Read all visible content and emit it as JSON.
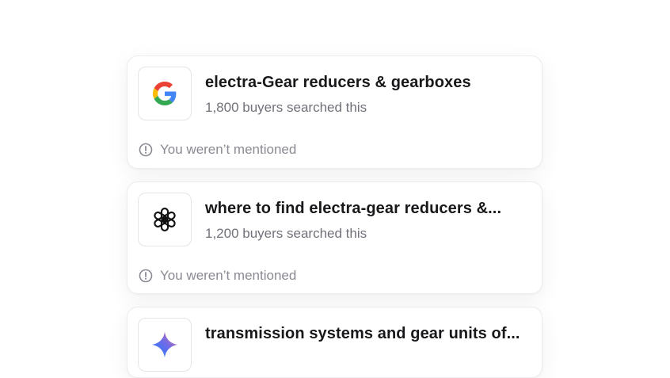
{
  "results": [
    {
      "engine_icon": "google-icon",
      "title": "electra-Gear reducers & gearboxes",
      "searches": "1,800 buyers searched this",
      "status": "You weren’t mentioned"
    },
    {
      "engine_icon": "openai-icon",
      "title": "where to find electra-gear reducers &...",
      "searches": "1,200 buyers searched this",
      "status": "You weren’t mentioned"
    },
    {
      "engine_icon": "gemini-icon",
      "title": "transmission systems and gear units of..."
    }
  ],
  "colors": {
    "google_blue": "#4285F4",
    "google_red": "#EA4335",
    "google_yellow": "#FBBC05",
    "google_green": "#34A853",
    "title": "#18181b",
    "muted": "#71717a"
  }
}
